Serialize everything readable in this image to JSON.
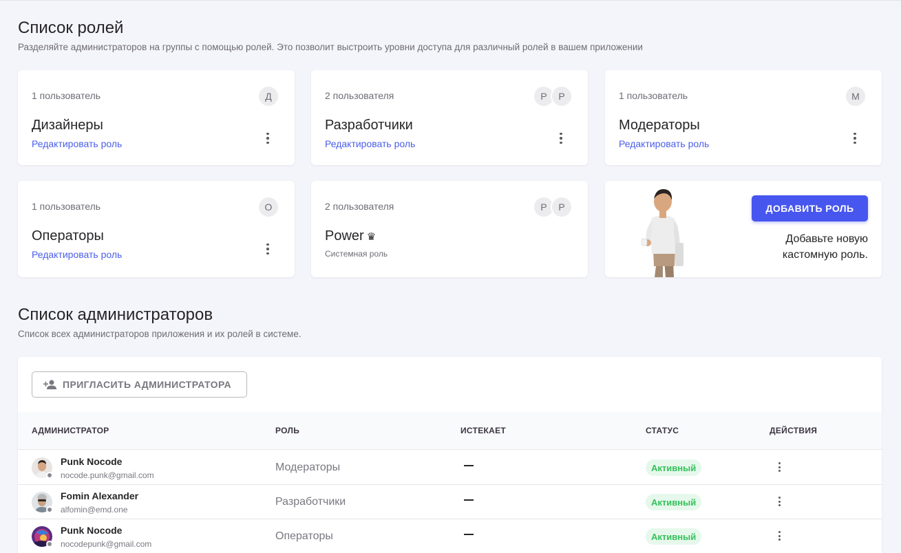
{
  "roles_section": {
    "title": "Список ролей",
    "subtitle": "Разделяйте администраторов на группы с помощью ролей. Это позволит выстроить уровни доступа для различный ролей в вашем приложении"
  },
  "roles": [
    {
      "count": "1 пользователь",
      "name": "Дизайнеры",
      "link": "Редактировать роль",
      "avatars": [
        "Д"
      ]
    },
    {
      "count": "2 пользователя",
      "name": "Разработчики",
      "link": "Редактировать роль",
      "avatars": [
        "Р",
        "Р"
      ]
    },
    {
      "count": "1 пользователь",
      "name": "Модераторы",
      "link": "Редактировать роль",
      "avatars": [
        "М"
      ]
    },
    {
      "count": "1 пользователь",
      "name": "Операторы",
      "link": "Редактировать роль",
      "avatars": [
        "О"
      ]
    },
    {
      "count": "2 пользователя",
      "name": "Power",
      "crown": "♛",
      "system_label": "Системная роль",
      "avatars": [
        "Р",
        "Р"
      ]
    }
  ],
  "add_role": {
    "button": "ДОБАВИТЬ РОЛЬ",
    "text_line1": "Добавьте новую",
    "text_line2": "кастомную роль."
  },
  "admins_section": {
    "title": "Список администраторов",
    "subtitle": "Список всех администраторов приложения и их ролей в системе."
  },
  "invite_button": "ПРИГЛАСИТЬ АДМИНИСТРАТОРА",
  "table": {
    "headers": [
      "АДМИНИСТРАТОР",
      "РОЛЬ",
      "ИСТЕКАЕТ",
      "СТАТУС",
      "ДЕЙСТВИЯ"
    ],
    "rows": [
      {
        "name": "Punk Nocode",
        "email": "nocode.punk@gmail.com",
        "role": "Модераторы",
        "status": "Активный"
      },
      {
        "name": "Fomin Alexander",
        "email": "alfomin@emd.one",
        "role": "Разработчики",
        "status": "Активный"
      },
      {
        "name": "Punk Nocode",
        "email": "nocodepunk@gmail.com",
        "role": "Операторы",
        "status": "Активный"
      }
    ]
  },
  "colors": {
    "accent": "#4756ee",
    "link": "#4a5ee8",
    "active_badge_bg": "#e6f8ec",
    "active_badge_text": "#35c15a"
  }
}
